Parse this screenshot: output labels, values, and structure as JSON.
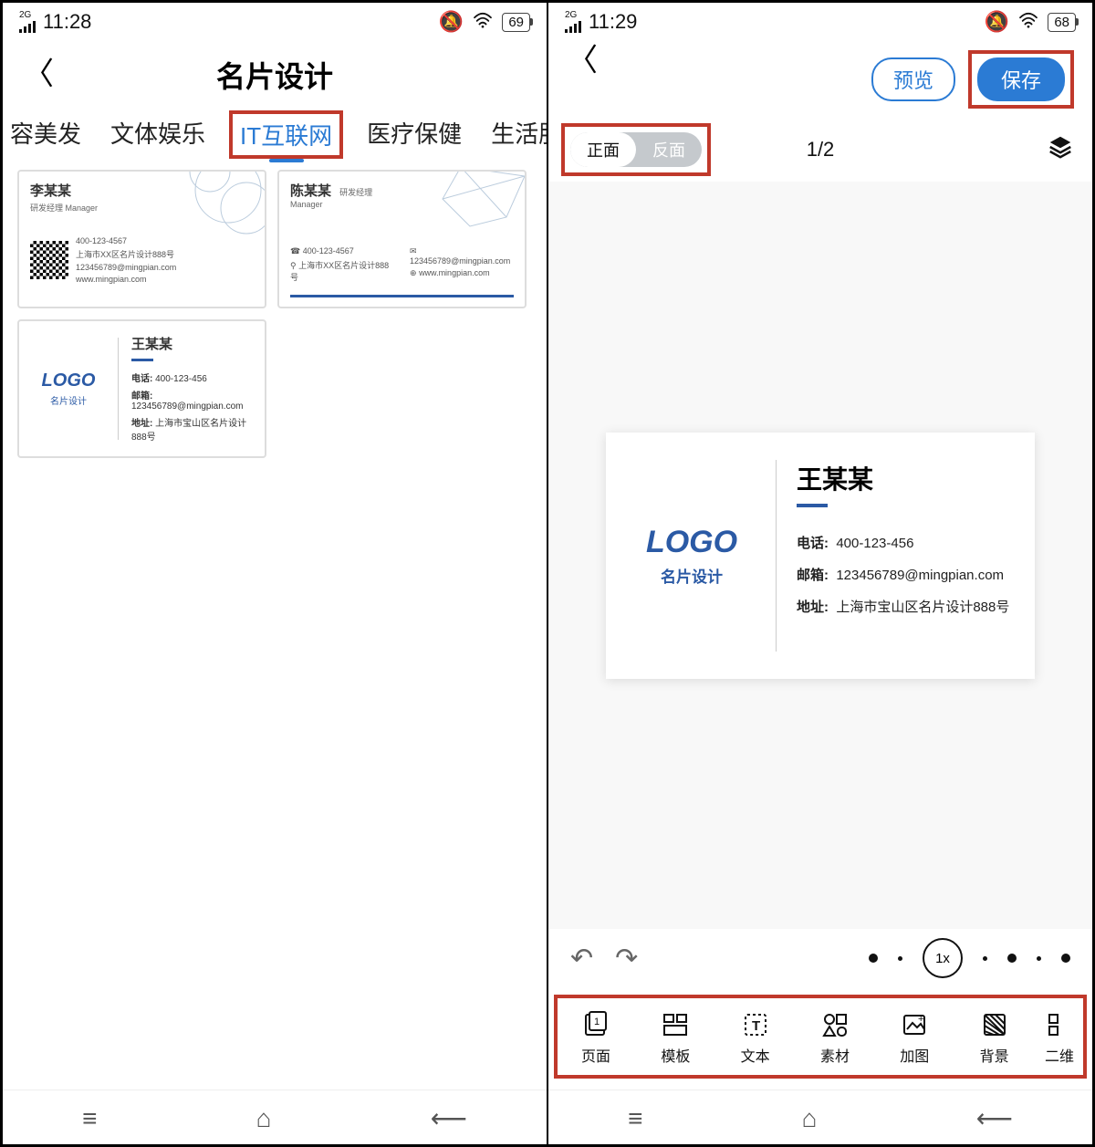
{
  "left": {
    "status": {
      "network": "2G",
      "time": "11:28",
      "battery": "69"
    },
    "header": {
      "title": "名片设计"
    },
    "tabs": [
      "容美发",
      "文体娱乐",
      "IT互联网",
      "医疗保健",
      "生活服"
    ],
    "active_tab_index": 2,
    "templates": [
      {
        "name": "李某某",
        "subtitle": "研发经理 Manager",
        "lines": [
          "400-123-4567",
          "上海市XX区名片设计888号",
          "123456789@mingpian.com",
          "www.mingpian.com"
        ]
      },
      {
        "name": "陈某某",
        "subtitle": "研发经理",
        "subtitle2": "Manager",
        "lines": [
          "400-123-4567",
          "上海市XX区名片设计888号",
          "123456789@mingpian.com",
          "www.mingpian.com"
        ]
      },
      {
        "logo_text": "LOGO",
        "logo_sub": "名片设计",
        "name": "王某某",
        "rows": [
          {
            "label": "电话:",
            "value": "400-123-456"
          },
          {
            "label": "邮箱:",
            "value": "123456789@mingpian.com"
          },
          {
            "label": "地址:",
            "value": "上海市宝山区名片设计888号"
          }
        ]
      }
    ]
  },
  "right": {
    "status": {
      "network": "2G",
      "time": "11:29",
      "battery": "68"
    },
    "header": {
      "preview": "预览",
      "save": "保存"
    },
    "sides": {
      "front": "正面",
      "back": "反面"
    },
    "page_indicator": "1/2",
    "card": {
      "logo_text": "LOGO",
      "logo_sub": "名片设计",
      "name": "王某某",
      "rows": [
        {
          "label": "电话:",
          "value": "400-123-456"
        },
        {
          "label": "邮箱:",
          "value": "123456789@mingpian.com"
        },
        {
          "label": "地址:",
          "value": "上海市宝山区名片设计888号"
        }
      ]
    },
    "zoom_label": "1x",
    "tools": [
      {
        "id": "page",
        "label": "页面"
      },
      {
        "id": "template",
        "label": "模板"
      },
      {
        "id": "text",
        "label": "文本"
      },
      {
        "id": "element",
        "label": "素材"
      },
      {
        "id": "image",
        "label": "加图"
      },
      {
        "id": "background",
        "label": "背景"
      },
      {
        "id": "qr",
        "label": "二维"
      }
    ]
  }
}
